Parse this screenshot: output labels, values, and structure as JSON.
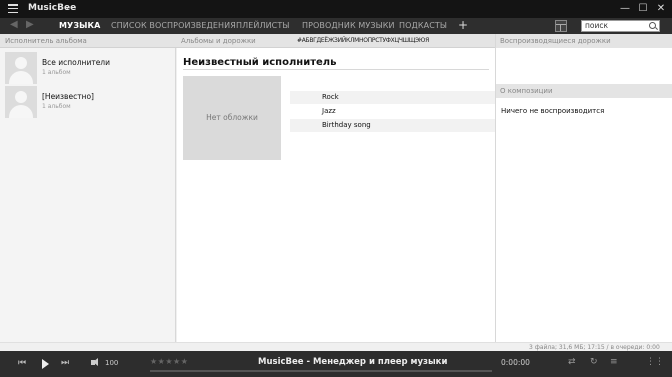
{
  "titlebar": {
    "app_title": "MusicBee",
    "chevron": "⌄",
    "minimize": "—",
    "maximize": "☐",
    "close": "✕"
  },
  "nav": {
    "back_icon": "arrow-left-icon",
    "forward_icon": "arrow-right-icon",
    "tabs": [
      {
        "label": "МУЗЫКА",
        "active": true
      },
      {
        "label": "СПИСОК ВОСПРОИЗВЕДЕНИЯ",
        "active": false
      },
      {
        "label": "ПЛЕЙЛИСТЫ",
        "active": false
      },
      {
        "label": "ПРОВОДНИК МУЗЫКИ",
        "active": false
      },
      {
        "label": "ПОДКАСТЫ",
        "active": false
      }
    ],
    "add_tab": "+",
    "search_placeholder": "поиск"
  },
  "headers": {
    "album_artist": "Исполнитель альбома",
    "albums_tracks": "Альбомы и дорожки",
    "alphabet": "#АБВГДЕЁЖЗИЙКЛМНОПРСТУФХЦЧШЩЭЮЯ"
  },
  "artists": [
    {
      "name": "Все исполнители",
      "count": "1 альбом"
    },
    {
      "name": "[Неизвестно]",
      "count": "1 альбом"
    }
  ],
  "album": {
    "artist_heading": "Неизвестный исполнитель",
    "no_cover": "Нет обложки",
    "tracks": [
      "Rock",
      "Jazz",
      "Birthday song"
    ]
  },
  "right_panel": {
    "queue_header": "Воспроизводящиеся дорожки",
    "info_header": "О композиции",
    "nothing_playing": "Ничего не воспроизводится"
  },
  "status": {
    "text": "3 файла; 31,6 МБ; 17:15 /    в очереди: 0:00"
  },
  "player": {
    "volume": "100",
    "rating_stars": "★★★★★",
    "now_playing": "MusicBee - Менеджер и плеер музыки",
    "time": "0:00:00",
    "prev_label": "⏮",
    "next_label": "⏭"
  }
}
